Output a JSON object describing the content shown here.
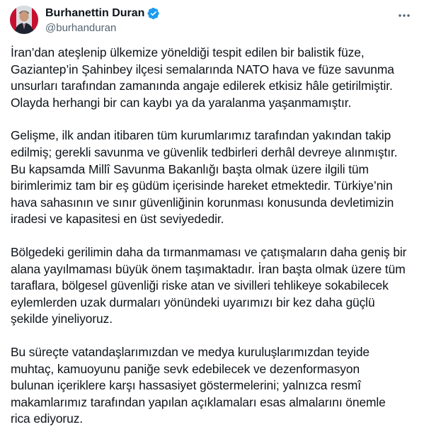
{
  "author": {
    "display_name": "Burhanettin Duran",
    "handle": "@burhanduran",
    "verified": true,
    "verified_color": "#1d9bf0"
  },
  "icons": {
    "verified": "verified-badge-icon",
    "more": "more-options-icon"
  },
  "tweet": {
    "paragraphs": [
      {
        "lines": [
          "İran’dan ateşlenip ülkemize yöneldiği tespit edilen bir balistik füze,",
          "Gaziantep’in Şahinbey ilçesi semalarında NATO hava ve füze savunma",
          "unsurları tarafından zamanında angaje edilerek etkisiz hâle getirilmiştir.",
          "Olayda herhangi bir can kaybı ya da yaralanma yaşanmamıştır."
        ]
      },
      {
        "lines": [
          "Gelişme, ilk andan itibaren tüm kurumlarımız tarafından yakından takip",
          "edilmiş; gerekli savunma ve güvenlik tedbirleri derhâl devreye alınmıştır.",
          "Bu kapsamda Millî Savunma Bakanlığı başta olmak üzere ilgili tüm",
          "birimlerimiz tam bir eş güdüm içerisinde hareket etmektedir. Türkiye’nin",
          "hava sahasının ve sınır güvenliğinin korunması konusunda devletimizin",
          "iradesi ve kapasitesi en üst seviyededir."
        ]
      },
      {
        "lines": [
          "Bölgedeki gerilimin daha da tırmanmaması ve çatışmaların daha geniş bir",
          "alana yayılmaması büyük önem taşımaktadır. İran başta olmak üzere tüm",
          "taraflara, bölgesel güvenliği riske atan ve sivilleri tehlikeye sokabilecek",
          "eylemlerden uzak durmaları yönündeki uyarımızı bir kez daha güçlü",
          "şekilde yineliyoruz."
        ]
      },
      {
        "lines": [
          "Bu süreçte vatandaşlarımızdan ve medya kuruluşlarımızdan teyide",
          "muhtaç, kamuoyunu paniğe sevk edebilecek ve dezenformasyon",
          "bulunan içeriklere karşı hassasiyet göstermelerini; yalnızca resmî",
          "makamlarımız tarafından yapılan açıklamaları esas almalarını önemle",
          "rica ediyoruz."
        ]
      }
    ]
  }
}
